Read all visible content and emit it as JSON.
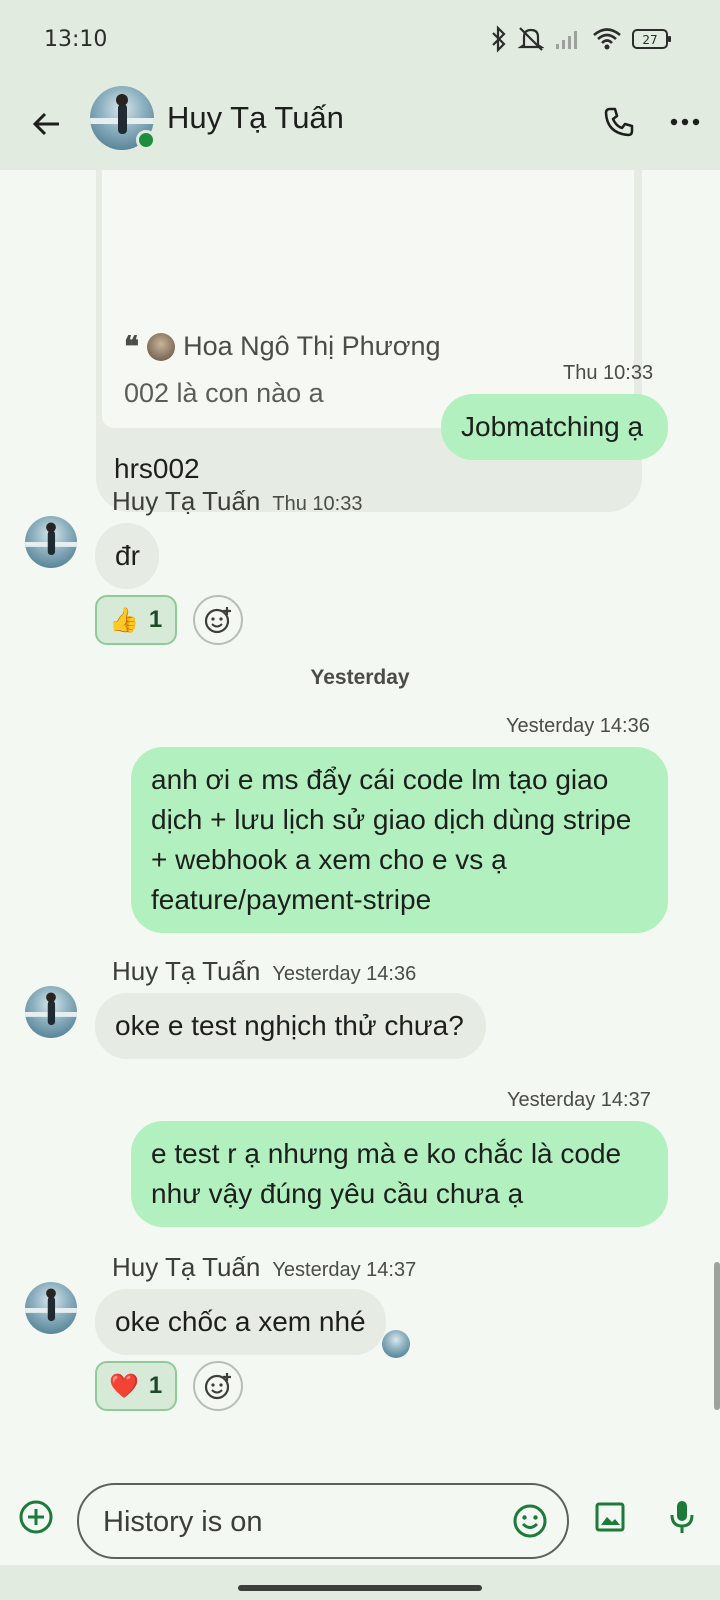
{
  "status_bar": {
    "time": "13:10",
    "battery": "27"
  },
  "header": {
    "contact_name": "Huy Tạ Tuấn"
  },
  "quoted_message": {
    "author": "Hoa Ngô Thị Phương",
    "quoted_text": "002 là con nào a",
    "reply_text": "hrs002"
  },
  "messages": [
    {
      "direction": "out",
      "timestamp": "Thu 10:33",
      "text": "Jobmatching ạ"
    },
    {
      "direction": "in",
      "sender": "Huy Tạ Tuấn",
      "timestamp": "Thu 10:33",
      "text": "đr",
      "reaction": {
        "emoji": "👍",
        "count": "1"
      }
    },
    {
      "direction": "out",
      "timestamp": "Yesterday 14:36",
      "text": "anh ơi e ms đẩy cái code lm tạo giao dịch + lưu lịch sử giao dịch dùng stripe + webhook a xem cho e vs ạ feature/payment-stripe"
    },
    {
      "direction": "in",
      "sender": "Huy Tạ Tuấn",
      "timestamp": "Yesterday 14:36",
      "text": "oke e test nghịch thử chưa?"
    },
    {
      "direction": "out",
      "timestamp": "Yesterday 14:37",
      "text": "e test r ạ nhưng mà e ko chắc là code như vậy đúng yêu cầu chưa ạ"
    },
    {
      "direction": "in",
      "sender": "Huy Tạ Tuấn",
      "timestamp": "Yesterday 14:37",
      "text": "oke chốc a xem nhé",
      "reaction": {
        "emoji": "❤️",
        "count": "1"
      }
    }
  ],
  "day_divider": "Yesterday",
  "composer": {
    "placeholder": "History is on"
  },
  "colors": {
    "outgoing_bubble": "#b2f0c0",
    "incoming_bubble": "#e6ebe4",
    "online": "#1e8e3e"
  }
}
